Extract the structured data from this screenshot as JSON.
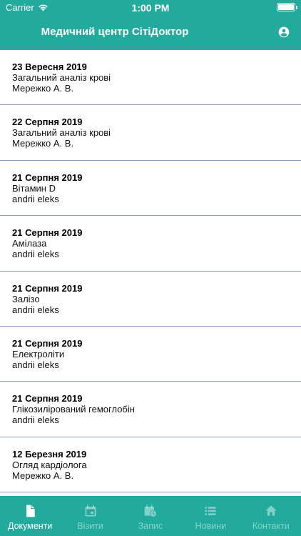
{
  "status": {
    "carrier": "Carrier",
    "time": "1:00 PM"
  },
  "header": {
    "title": "Медичний центр СітіДоктор",
    "profile_icon": "account-circle-icon"
  },
  "items": [
    {
      "date": "23 Вересня 2019",
      "desc": "Загальний аналіз крові",
      "doctor": "Мережко А. В."
    },
    {
      "date": "22 Серпня 2019",
      "desc": "Загальний аналіз крові",
      "doctor": "Мережко А. В."
    },
    {
      "date": "21 Серпня 2019",
      "desc": "Вітамин D",
      "doctor": "andrii eleks"
    },
    {
      "date": "21 Серпня 2019",
      "desc": "Амілаза",
      "doctor": "andrii eleks"
    },
    {
      "date": "21 Серпня 2019",
      "desc": "Залізо",
      "doctor": "andrii eleks"
    },
    {
      "date": "21 Серпня 2019",
      "desc": "Електроліти",
      "doctor": "andrii eleks"
    },
    {
      "date": "21 Серпня 2019",
      "desc": "Глікозилірований гемоглобін",
      "doctor": "andrii eleks"
    },
    {
      "date": "12 Березня 2019",
      "desc": "Огляд кардіолога",
      "doctor": "Мережко А. В."
    }
  ],
  "tabs": [
    {
      "label": "Документи",
      "icon": "document-icon",
      "active": true
    },
    {
      "label": "Візити",
      "icon": "calendar-icon",
      "active": false
    },
    {
      "label": "Запис",
      "icon": "calendar-clock-icon",
      "active": false
    },
    {
      "label": "Новини",
      "icon": "list-icon",
      "active": false
    },
    {
      "label": "Контакти",
      "icon": "home-icon",
      "active": false
    }
  ],
  "colors": {
    "primary": "#22ab9d",
    "divider": "#8aa0c2"
  }
}
